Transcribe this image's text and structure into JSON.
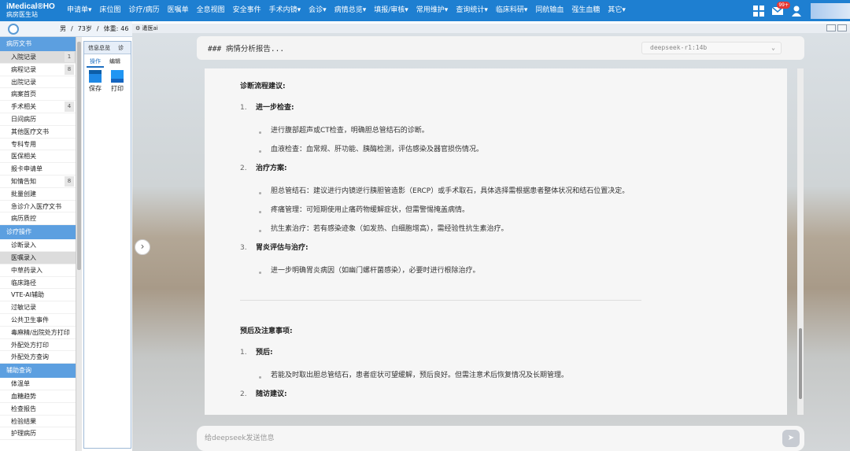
{
  "app": {
    "logo": "iMedical®HO",
    "subtitle": "病房医生站"
  },
  "menu": [
    "申请单▾",
    "床位图",
    "诊疗/病历",
    "医嘱单",
    "全息视图",
    "安全事件",
    "手术内镜▾",
    "会诊▾",
    "病情总览▾",
    "填报/审核▾",
    "常用维护▾",
    "查询统计▾",
    "临床科研▾",
    "同航输血",
    "强生血糖",
    "其它▾"
  ],
  "top_right": {
    "badge": "99+"
  },
  "patient": {
    "gender": "男",
    "age": "73岁",
    "weight_label": "体重:",
    "weight": "46"
  },
  "sidebar": {
    "sections": [
      {
        "title": "病历文书",
        "items": [
          {
            "label": "入院记录",
            "count": "1",
            "active": true
          },
          {
            "label": "病程记录",
            "count": "8"
          },
          {
            "label": "出院记录"
          },
          {
            "label": "病案首页"
          },
          {
            "label": "手术相关",
            "count": "4"
          },
          {
            "label": "日间病历"
          },
          {
            "label": "其他医疗文书"
          },
          {
            "label": "专科专用"
          },
          {
            "label": "医保相关"
          },
          {
            "label": "报卡申请单"
          },
          {
            "label": "知情告知",
            "count": "8"
          },
          {
            "label": "批量创建"
          },
          {
            "label": "急诊介入医疗文书"
          },
          {
            "label": "病历质控"
          }
        ]
      },
      {
        "title": "诊疗操作",
        "items": [
          {
            "label": "诊断录入"
          },
          {
            "label": "医嘱录入",
            "active": true
          },
          {
            "label": "中草药录入"
          },
          {
            "label": "临床路径"
          },
          {
            "label": "VTE-AI辅助"
          },
          {
            "label": "过敏记录"
          },
          {
            "label": "公共卫生事件"
          },
          {
            "label": "毒麻精/出院处方打印"
          },
          {
            "label": "外配处方打印"
          },
          {
            "label": "外配处方查询"
          }
        ]
      },
      {
        "title": "辅助查询",
        "items": [
          {
            "label": "体温单"
          },
          {
            "label": "血糖趋势"
          },
          {
            "label": "检查报告"
          },
          {
            "label": "检验结果"
          },
          {
            "label": "护理病历"
          }
        ]
      }
    ]
  },
  "toolpanel": {
    "tabs_header": [
      "信息总览",
      "诊"
    ],
    "tabs": [
      "操作",
      "编辑"
    ],
    "buttons": [
      "保存",
      "打印"
    ]
  },
  "main": {
    "tab_title": "遣医ai",
    "report_header": "### 病情分析报告...",
    "model": "deepseek-r1:14b",
    "input_placeholder": "给deepseek发送信息",
    "section1_title": "诊断流程建议:",
    "s1_items": [
      {
        "num": "1.",
        "title": "进一步检查:",
        "bullets": [
          "进行腹部超声或CT检查，明确胆总管结石的诊断。",
          "血液检查：血常规、肝功能、胰酶检测，评估感染及器官损伤情况。"
        ]
      },
      {
        "num": "2.",
        "title": "治疗方案:",
        "bullets": [
          "胆总管结石：建议进行内镜逆行胰胆管造影（ERCP）或手术取石，具体选择需根据患者整体状况和结石位置决定。",
          "疼痛管理：可短期使用止痛药物缓解症状，但需警惕掩盖病情。",
          "抗生素治疗：若有感染迹象（如发热、白细胞增高），需经验性抗生素治疗。"
        ]
      },
      {
        "num": "3.",
        "title": "胃炎评估与治疗:",
        "bullets": [
          "进一步明确胃炎病因（如幽门螺杆菌感染），必要时进行根除治疗。"
        ]
      }
    ],
    "section2_title": "预后及注意事项:",
    "s2_items": [
      {
        "num": "1.",
        "title": "预后:",
        "bullets": [
          "若能及时取出胆总管结石，患者症状可望缓解，预后良好。但需注意术后恢复情况及长期管理。"
        ]
      },
      {
        "num": "2.",
        "title": "随访建议:",
        "bullets": []
      }
    ]
  }
}
